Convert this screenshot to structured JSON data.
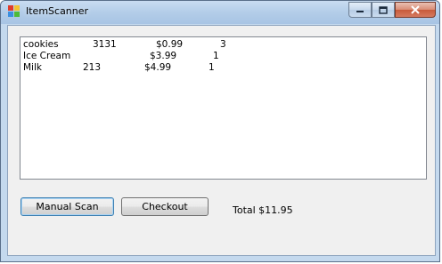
{
  "window": {
    "title": "ItemScanner"
  },
  "caption_buttons": {
    "minimize": "🗕",
    "maximize": "🗖",
    "close": "✕"
  },
  "items": [
    {
      "name": "cookies",
      "code": "3131",
      "price": "$0.99",
      "qty": "3"
    },
    {
      "name": "Ice Cream",
      "code": "",
      "price": "$3.99",
      "qty": "1"
    },
    {
      "name": "Milk",
      "code": "213",
      "price": "$4.99",
      "qty": "1"
    }
  ],
  "buttons": {
    "manual_scan": "Manual Scan",
    "checkout": "Checkout"
  },
  "total_label": "Total $11.95",
  "colors": {
    "titlebar": "#b3cde8",
    "client": "#f0f0f0",
    "close_button": "#c85a3b"
  }
}
